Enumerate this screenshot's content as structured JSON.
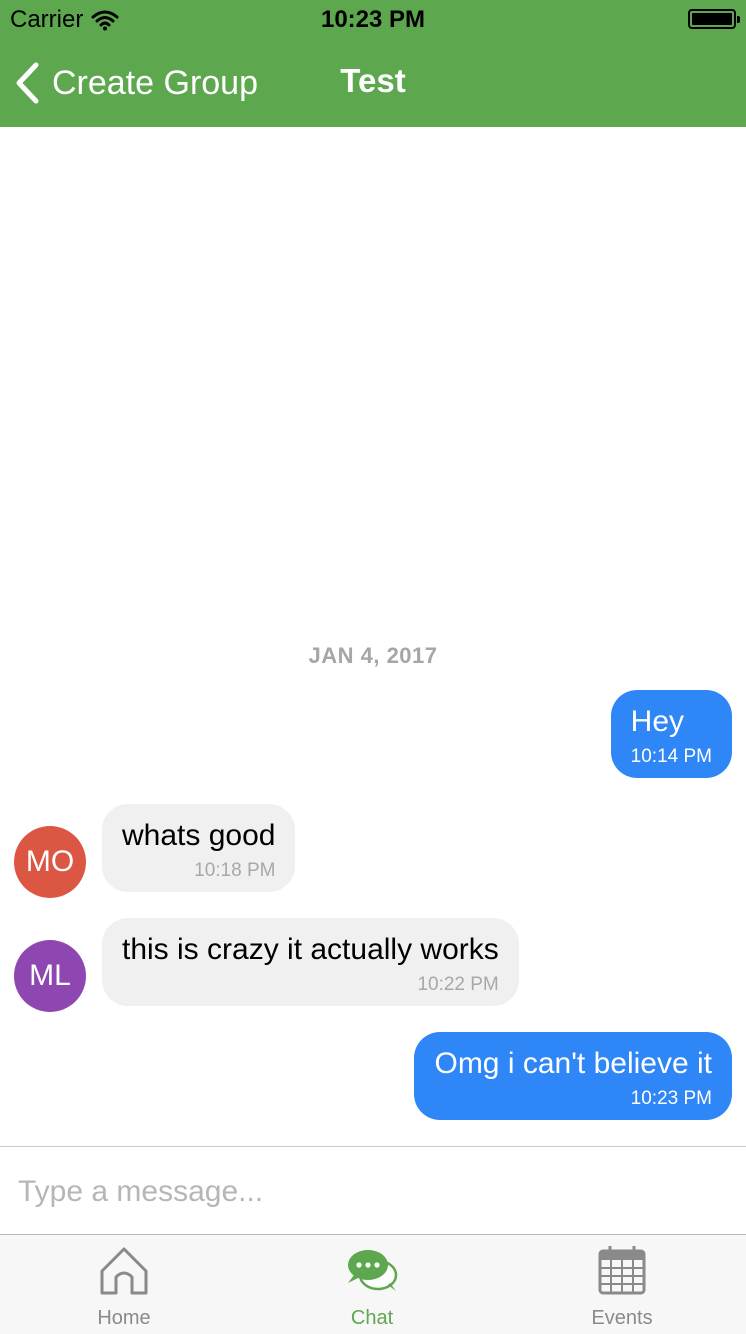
{
  "status_bar": {
    "carrier": "Carrier",
    "time": "10:23 PM"
  },
  "nav": {
    "back_label": "Create Group",
    "title": "Test"
  },
  "chat": {
    "date": "JAN 4, 2017",
    "messages": [
      {
        "direction": "out",
        "text": "Hey",
        "time": "10:14 PM"
      },
      {
        "direction": "in",
        "initials": "MO",
        "avatar_color": "#db5743",
        "text": "whats good",
        "time": "10:18 PM"
      },
      {
        "direction": "in",
        "initials": "ML",
        "avatar_color": "#8e46b0",
        "text": "this is crazy it actually works",
        "time": "10:22 PM"
      },
      {
        "direction": "out",
        "text": "Omg i can't believe it",
        "time": "10:23 PM"
      }
    ]
  },
  "composer": {
    "placeholder": "Type a message...",
    "value": ""
  },
  "tabs": [
    {
      "label": "Home",
      "icon": "home-icon",
      "active": false
    },
    {
      "label": "Chat",
      "icon": "chat-icon",
      "active": true
    },
    {
      "label": "Events",
      "icon": "calendar-icon",
      "active": false
    }
  ],
  "colors": {
    "header_green": "#5da74e",
    "outgoing_bubble": "#2f86f6",
    "incoming_bubble": "#f0f0f0",
    "active_tab": "#5da74e"
  }
}
